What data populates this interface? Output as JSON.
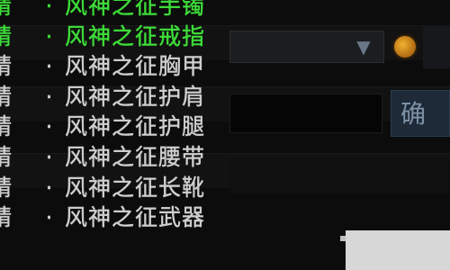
{
  "items": [
    {
      "prefix": "精",
      "separator": "·",
      "name": "风神之征手镯",
      "color": "#3fdc3a"
    },
    {
      "prefix": "精",
      "separator": "·",
      "name": "风神之征戒指",
      "color": "#3fdc3a"
    },
    {
      "prefix": "精",
      "separator": "·",
      "name": "风神之征胸甲",
      "color": "#cfcfcf"
    },
    {
      "prefix": "精",
      "separator": "·",
      "name": "风神之征护肩",
      "color": "#cfcfcf"
    },
    {
      "prefix": "精",
      "separator": "·",
      "name": "风神之征护腿",
      "color": "#cfcfcf"
    },
    {
      "prefix": "精",
      "separator": "·",
      "name": "风神之征腰带",
      "color": "#cfcfcf"
    },
    {
      "prefix": "精",
      "separator": "·",
      "name": "风神之征长靴",
      "color": "#cfcfcf"
    },
    {
      "prefix": "精",
      "separator": "·",
      "name": "风神之征武器",
      "color": "#cfcfcf"
    }
  ],
  "controls": {
    "dropdown_arrow": "▼",
    "side_button_label": "确",
    "coin_icon": "coin-icon"
  },
  "colors": {
    "background": "#0c0c0c",
    "highlight_green": "#3fdc3a",
    "normal_gray": "#cfcfcf",
    "button_blue": "#1e2a38"
  }
}
